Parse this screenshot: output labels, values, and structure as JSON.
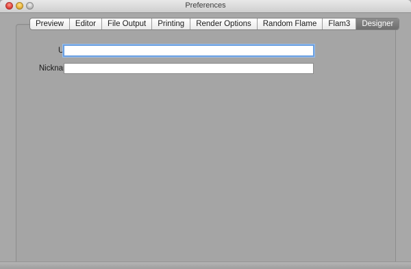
{
  "window": {
    "title": "Preferences"
  },
  "tabs": [
    {
      "label": "Preview",
      "selected": false
    },
    {
      "label": "Editor",
      "selected": false
    },
    {
      "label": "File Output",
      "selected": false
    },
    {
      "label": "Printing",
      "selected": false
    },
    {
      "label": "Render Options",
      "selected": false
    },
    {
      "label": "Random Flame",
      "selected": false
    },
    {
      "label": "Flam3",
      "selected": false
    },
    {
      "label": "Designer",
      "selected": true
    }
  ],
  "form": {
    "url_label": "URL",
    "url_value": "",
    "nickname_label": "Nickname",
    "nickname_value": ""
  },
  "colors": {
    "focus_ring": "#6a9fe0",
    "selected_tab": "#7a7a7a",
    "background": "#a8a8a8"
  }
}
